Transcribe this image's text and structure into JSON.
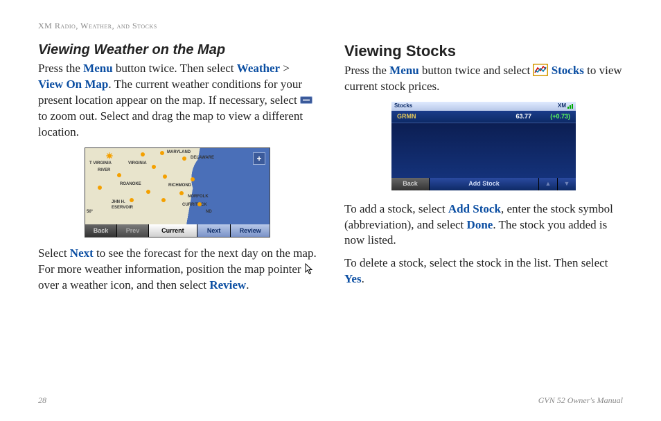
{
  "header": "XM Radio, Weather, and Stocks",
  "left": {
    "title": "Viewing Weather on the Map",
    "p1_a": "Press the ",
    "menu": "Menu",
    "p1_b": " button twice. Then select ",
    "weather": "Weather",
    "gt": " > ",
    "view_on_map": "View On Map",
    "p1_c": ". The current weather conditions for your present location appear on the map. If necessary, select ",
    "p1_d": " to zoom out. Select and drag the map to view a different location.",
    "p2_a": "Select ",
    "next": "Next",
    "p2_b": " to see the forecast for the next day on the map. For more weather information, position the map pointer ",
    "p2_c": " over a weather icon, and then select ",
    "review": "Review",
    "p2_d": "."
  },
  "map": {
    "tabs": {
      "back": "Back",
      "prev": "Prev",
      "current": "Current",
      "next": "Next",
      "review": "Review"
    },
    "labels": {
      "virginia": "VIRGINIA",
      "wvirginia": "T VIRGINIA",
      "river": "RIVER",
      "roanoke": "ROANOKE",
      "richmond": "RICHMOND",
      "norfolk": "NORFOLK",
      "currituck": "CURRITUCK",
      "delaware": "DELAWARE",
      "maryland": "MARYLAND",
      "nd": "ND",
      "john": "JHN H.",
      "reservoir": "ESERVOIR",
      "fifty": "50°"
    },
    "plus": "+"
  },
  "right": {
    "title": "Viewing Stocks",
    "p1_a": "Press the ",
    "menu": "Menu",
    "p1_b": " button twice and select ",
    "stocks": "Stocks",
    "p1_c": " to view current stock prices.",
    "p2_a": "To add a stock, select ",
    "add_stock": "Add Stock",
    "p2_b": ", enter the stock symbol (abbreviation), and select ",
    "done": "Done",
    "p2_c": ". The stock you added is now listed.",
    "p3_a": "To delete a stock, select the stock in the list. Then select ",
    "yes": "Yes",
    "p3_b": "."
  },
  "stocks_fig": {
    "title": "Stocks",
    "xm": "XM",
    "row": {
      "sym": "GRMN",
      "price": "63.77",
      "chg": "(+0.73)"
    },
    "tabs": {
      "back": "Back",
      "add": "Add Stock",
      "up": "▲",
      "down": "▼"
    }
  },
  "footer": {
    "page": "28",
    "manual": "GVN 52 Owner's Manual"
  }
}
